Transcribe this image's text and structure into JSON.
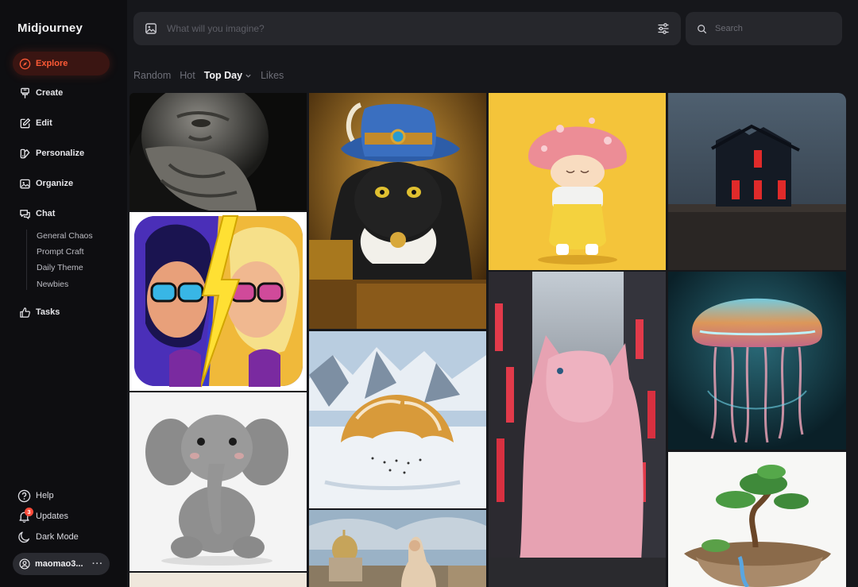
{
  "app": {
    "name": "Midjourney"
  },
  "nav": {
    "explore": "Explore",
    "create": "Create",
    "edit": "Edit",
    "personalize": "Personalize",
    "organize": "Organize",
    "chat": "Chat",
    "tasks": "Tasks"
  },
  "chat_rooms": [
    "General Chaos",
    "Prompt Craft",
    "Daily Theme",
    "Newbies"
  ],
  "footer": {
    "help": "Help",
    "updates": "Updates",
    "updates_count": "3",
    "dark_mode": "Dark Mode",
    "username": "maomao3...",
    "more": "···"
  },
  "prompt": {
    "placeholder": "What will you imagine?",
    "value": ""
  },
  "search": {
    "placeholder": "Search",
    "value": ""
  },
  "filters": {
    "random": "Random",
    "hot": "Hot",
    "top_day": "Top Day",
    "likes": "Likes"
  },
  "colors": {
    "accent": "#ff5a36",
    "sidebar_bg": "#0e0e11",
    "page_bg": "#16171b",
    "input_bg": "#26272c",
    "badge": "#ff4b3a"
  },
  "gallery": [
    {
      "subject": "marble bearded statue"
    },
    {
      "subject": "cartoon girls split by lightning"
    },
    {
      "subject": "plush grey elephant"
    },
    {
      "subject": "black cat wearing ornate blue hat"
    },
    {
      "subject": "giant croissant on snowy mountains"
    },
    {
      "subject": "woman before domed cathedral"
    },
    {
      "subject": "mushroom-head toy figure"
    },
    {
      "subject": "giant pink cat in neon city street"
    },
    {
      "subject": "dark house with red windows"
    },
    {
      "subject": "glowing jellyfish"
    },
    {
      "subject": "bonsai tree on floating rock"
    }
  ]
}
